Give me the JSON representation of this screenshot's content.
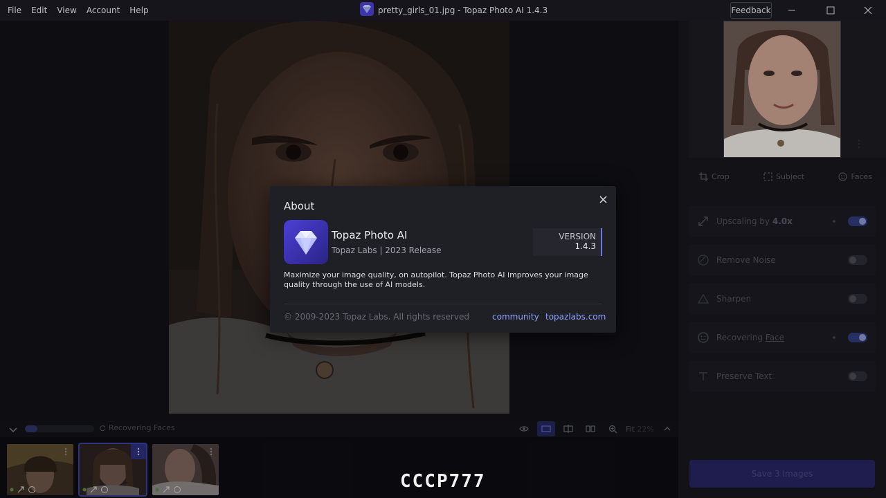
{
  "menu": [
    "File",
    "Edit",
    "View",
    "Account",
    "Help"
  ],
  "window": {
    "title": "pretty_girls_01.jpg - Topaz Photo AI 1.4.3",
    "feedback": "Feedback"
  },
  "tools": {
    "crop": "Crop",
    "subject": "Subject",
    "faces": "Faces"
  },
  "features": {
    "upscaling_prefix": "Upscaling by ",
    "upscaling_value": "4.0x",
    "upscaling_on": true,
    "remove_noise": "Remove Noise",
    "remove_noise_on": false,
    "sharpen": "Sharpen",
    "sharpen_on": false,
    "recovering_prefix": "Recovering ",
    "recovering_link": "Face",
    "recovering_on": true,
    "preserve_text": "Preserve Text",
    "preserve_text_on": false
  },
  "save_button": "Save 3 Images",
  "status": {
    "label": "Recovering Faces",
    "progress": 0.18
  },
  "view": {
    "fit": "Fit",
    "zoom": "22%"
  },
  "dialog": {
    "title": "About",
    "app_name": "Topaz Photo AI",
    "publisher": "Topaz Labs | 2023 Release",
    "version_label": "VERSION",
    "version": "1.4.3",
    "description": "Maximize your image quality, on autopilot. Topaz Photo AI improves your image quality through the use of AI models.",
    "copyright": "© 2009-2023 Topaz Labs. All rights reserved",
    "link_community": "community",
    "link_site": "topazlabs.com"
  },
  "watermark": "CCCP777",
  "colors": {
    "accent": "#6f77e4",
    "link": "#8fa3ff",
    "dialog_bg": "#1f1f26",
    "app_bg": "#131319"
  }
}
